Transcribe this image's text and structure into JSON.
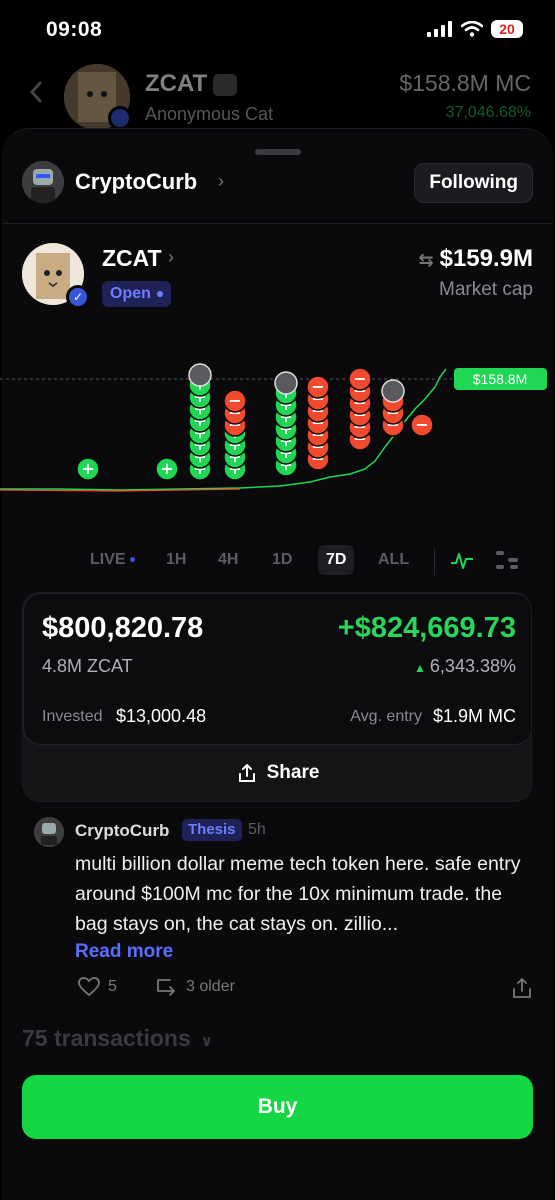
{
  "status_bar": {
    "time": "09:08",
    "battery": "20"
  },
  "background_header": {
    "token_name": "ZCAT",
    "subtitle": "Anonymous Cat",
    "market_cap": "$158.8M MC",
    "change_pct": "37,046.68%"
  },
  "creator": {
    "name": "CryptoCurb",
    "follow_label": "Following"
  },
  "token": {
    "name": "ZCAT",
    "status": "Open",
    "market_cap_value": "$159.9M",
    "market_cap_label": "Market cap"
  },
  "chart": {
    "current_price_label": "$158.8M",
    "colors": {
      "buy": "#1fd655",
      "sell": "#f24a2f",
      "price_tag": "#1fd655"
    }
  },
  "timeframes": [
    {
      "label": "LIVE"
    },
    {
      "label": "1H"
    },
    {
      "label": "4H"
    },
    {
      "label": "1D"
    },
    {
      "label": "7D",
      "active": true
    },
    {
      "label": "ALL"
    }
  ],
  "position": {
    "value": "$800,820.78",
    "pnl": "+$824,669.73",
    "quantity": "4.8M ZCAT",
    "pnl_pct": "6,343.38%",
    "invested_label": "Invested",
    "invested_value": "$13,000.48",
    "avg_entry_label": "Avg. entry",
    "avg_entry_value": "$1.9M MC",
    "share_label": "Share"
  },
  "thesis": {
    "author": "CryptoCurb",
    "badge": "Thesis",
    "time": "5h",
    "text": "multi billion dollar meme tech token here. safe entry around $100M mc for the 10x minimum trade. the bag stays on, the cat stays on. zillio...",
    "read_more": "Read more",
    "likes": "5",
    "older": "3 older"
  },
  "transactions_label": "75 transactions",
  "buy_label": "Buy"
}
